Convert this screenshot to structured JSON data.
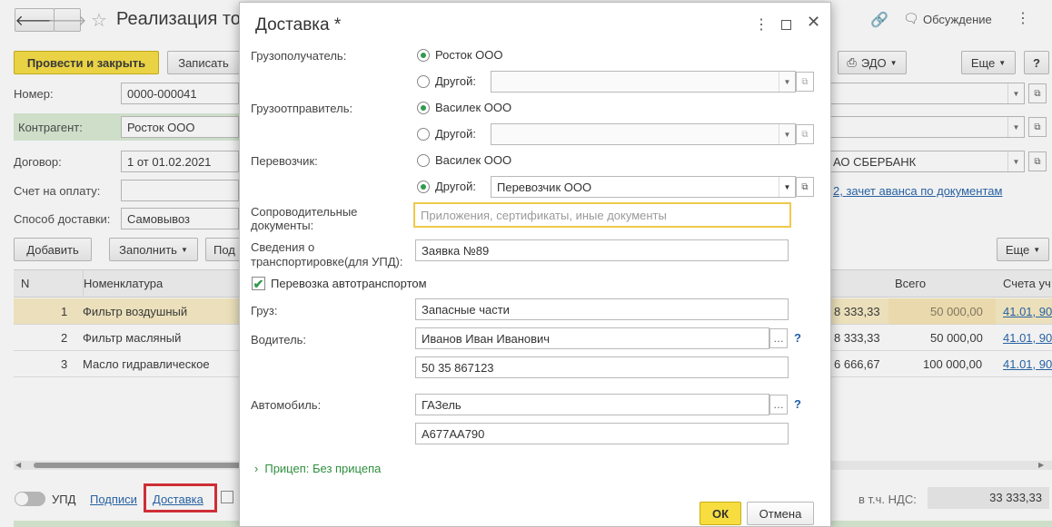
{
  "background": {
    "doc_title": "Реализация тов",
    "toolbar": {
      "post_close": "Провести и закрыть",
      "write": "Записать",
      "edo": "ЭДО",
      "more": "Еще",
      "help": "?"
    },
    "discuss": "Обсуждение",
    "fields": {
      "number_label": "Номер:",
      "number_value": "0000-000041",
      "counterparty_label": "Контрагент:",
      "counterparty_value": "Росток ООО",
      "contract_label": "Договор:",
      "contract_value": "1 от 01.02.2021",
      "invoice_label": "Счет на оплату:",
      "delivery_method_label": "Способ доставки:",
      "delivery_method_value": "Самовывоз",
      "bank_value": "АО СБЕРБАНК",
      "advance_link": "2, зачет аванса по документам"
    },
    "table_toolbar": {
      "add": "Добавить",
      "fill": "Заполнить",
      "pod": "Под",
      "more": "Еще"
    },
    "table": {
      "headers": {
        "n": "N",
        "nomenclature": "Номенклатура",
        "total": "Всего",
        "accounts": "Счета уч"
      },
      "rows": [
        {
          "n": "1",
          "name": "Фильтр воздушный",
          "vat": "8 333,33",
          "total": "50 000,00",
          "acc": "41.01, 90"
        },
        {
          "n": "2",
          "name": "Фильтр масляный",
          "vat": "8 333,33",
          "total": "50 000,00",
          "acc": "41.01, 90"
        },
        {
          "n": "3",
          "name": "Масло гидравлическое",
          "vat": "6 666,67",
          "total": "100 000,00",
          "acc": "41.01, 90"
        }
      ]
    },
    "bottom": {
      "upd": "УПД",
      "signatures": "Подписи",
      "delivery": "Доставка",
      "vat_label": "в т.ч. НДС:",
      "vat_value": "33 333,33"
    }
  },
  "dialog": {
    "title": "Доставка *",
    "consignee_label": "Грузополучатель:",
    "consignee_option1": "Росток ООО",
    "other": "Другой:",
    "consignor_label": "Грузоотправитель:",
    "consignor_option1": "Василек ООО",
    "carrier_label": "Перевозчик:",
    "carrier_option1": "Василек ООО",
    "carrier_other_value": "Перевозчик ООО",
    "docs_label_1": "Сопроводительные",
    "docs_label_2": "документы:",
    "docs_placeholder": "Приложения, сертификаты, иные документы",
    "transport_label_1": "Сведения о",
    "transport_label_2": "транспортировке(для УПД):",
    "transport_value": "Заявка №89",
    "auto_transport": "Перевозка автотранспортом",
    "cargo_label": "Груз:",
    "cargo_value": "Запасные части",
    "driver_label": "Водитель:",
    "driver_value": "Иванов Иван Иванович",
    "driver_doc_value": "50 35 867123",
    "car_label": "Автомобиль:",
    "car_value": "ГАЗель",
    "car_number_value": "А677АА790",
    "help": "?",
    "trailer": "Прицеп: Без прицепа",
    "ok": "ОК",
    "cancel": "Отмена"
  }
}
